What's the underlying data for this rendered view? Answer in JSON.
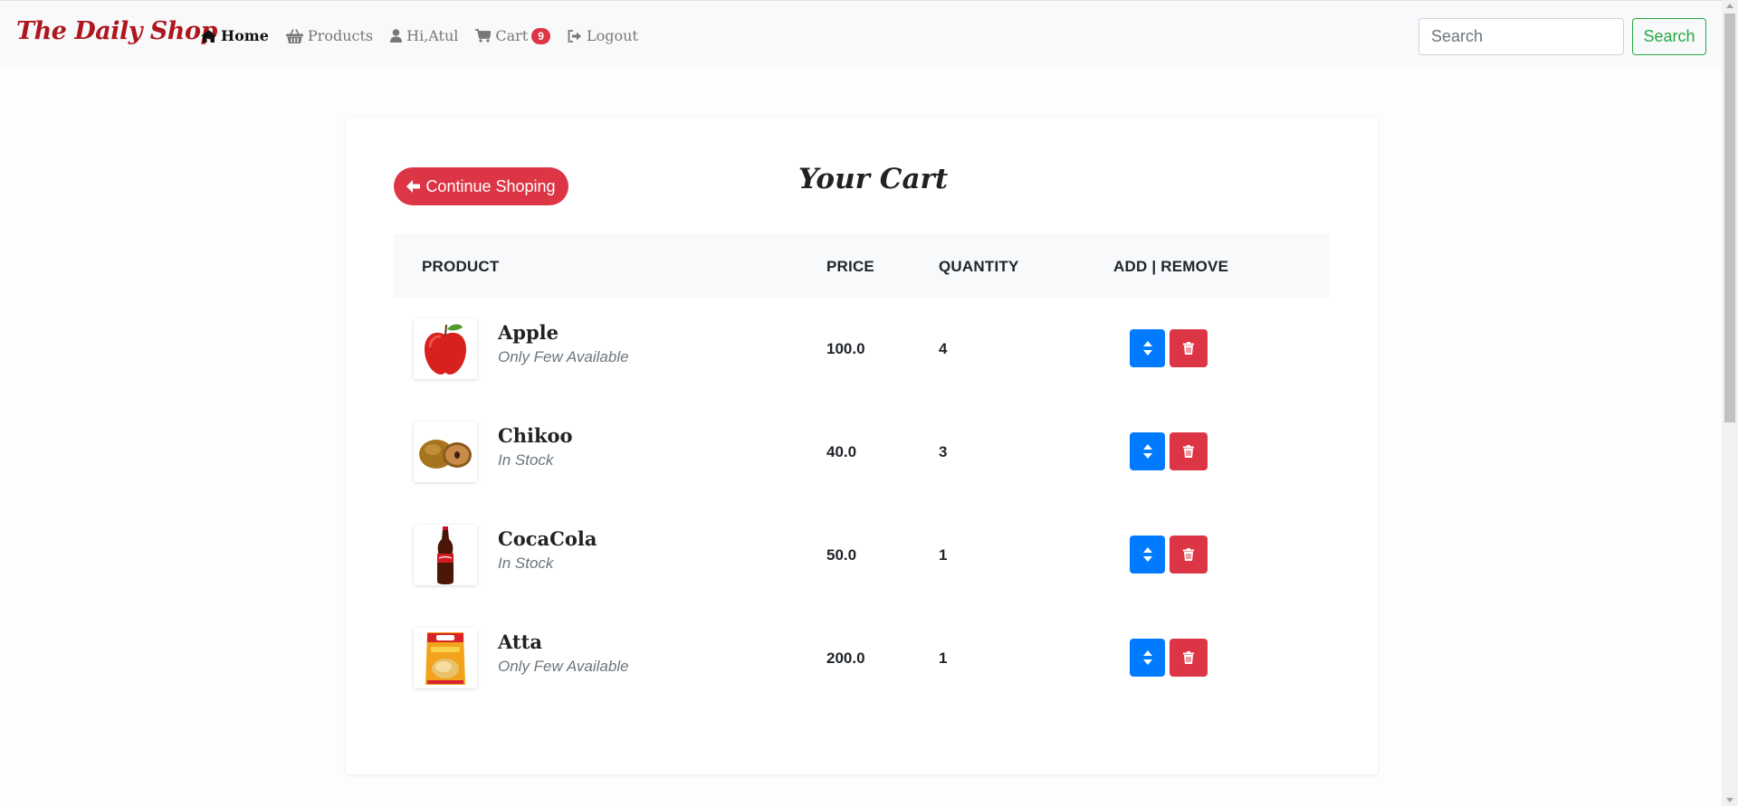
{
  "navbar": {
    "brand": "The Daily Shop",
    "items": [
      {
        "label": "Home",
        "icon": "home-icon",
        "active": true
      },
      {
        "label": "Products",
        "icon": "basket-icon",
        "active": false
      },
      {
        "label": "Hi,Atul",
        "icon": "user-icon",
        "active": false
      },
      {
        "label": "Cart",
        "icon": "cart-icon",
        "active": false,
        "badge": "9"
      },
      {
        "label": "Logout",
        "icon": "logout-icon",
        "active": false
      }
    ],
    "search": {
      "placeholder": "Search",
      "value": "",
      "button_label": "Search"
    }
  },
  "cart": {
    "continue_label": "Continue Shoping",
    "title": "Your Cart",
    "headers": {
      "product": "PRODUCT",
      "price": "PRICE",
      "quantity": "QUANTITY",
      "actions": "ADD | REMOVE"
    },
    "items": [
      {
        "name": "Apple",
        "status": "Only Few Available",
        "price": "100.0",
        "quantity": "4"
      },
      {
        "name": "Chikoo",
        "status": "In Stock",
        "price": "40.0",
        "quantity": "3"
      },
      {
        "name": "CocaCola",
        "status": "In Stock",
        "price": "50.0",
        "quantity": "1"
      },
      {
        "name": "Atta",
        "status": "Only Few Available",
        "price": "200.0",
        "quantity": "1"
      }
    ]
  },
  "colors": {
    "brand": "#b0161d",
    "danger": "#dc3545",
    "primary": "#007bff",
    "success": "#28a745",
    "navbar_bg": "#f8f9fa"
  }
}
